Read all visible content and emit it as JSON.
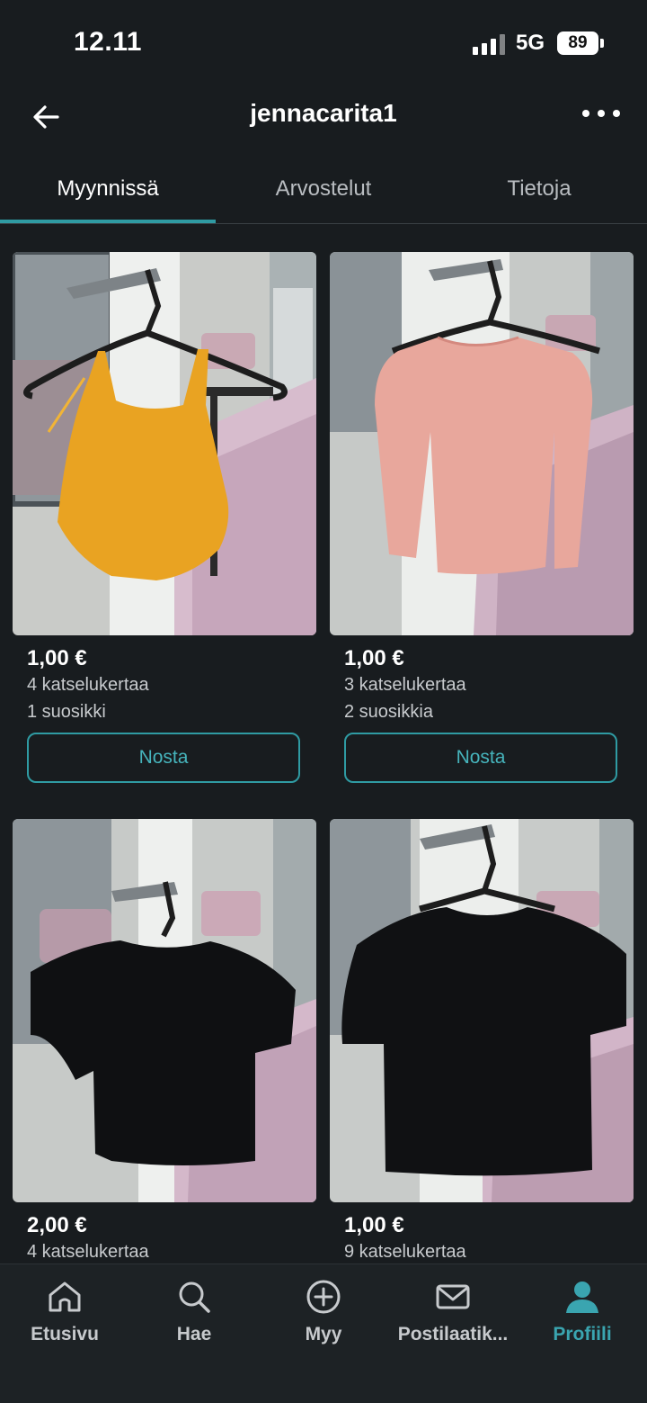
{
  "status": {
    "time": "12.11",
    "network": "5G",
    "battery": "89"
  },
  "header": {
    "title": "jennacarita1",
    "back_icon": "arrow-left-icon",
    "more_icon": "more-dots-icon"
  },
  "tabs": [
    {
      "label": "Myynnissä",
      "active": true
    },
    {
      "label": "Arvostelut",
      "active": false
    },
    {
      "label": "Tietoja",
      "active": false
    }
  ],
  "items": [
    {
      "price": "1,00 €",
      "views": "4 katselukertaa",
      "favorites": "1 suosikki",
      "action": "Nosta",
      "garment_color": "#e9a322"
    },
    {
      "price": "1,00 €",
      "views": "3 katselukertaa",
      "favorites": "2 suosikkia",
      "action": "Nosta",
      "garment_color": "#e8a79c"
    },
    {
      "price": "2,00 €",
      "views": "4 katselukertaa",
      "garment_color": "#0f1012"
    },
    {
      "price": "1,00 €",
      "views": "9 katselukertaa",
      "garment_color": "#101113"
    }
  ],
  "nav": [
    {
      "label": "Etusivu",
      "icon": "home-icon",
      "active": false
    },
    {
      "label": "Hae",
      "icon": "search-icon",
      "active": false
    },
    {
      "label": "Myy",
      "icon": "plus-circle-icon",
      "active": false
    },
    {
      "label": "Postilaatik...",
      "icon": "mail-icon",
      "active": false
    },
    {
      "label": "Profiili",
      "icon": "profile-icon",
      "active": true
    }
  ],
  "colors": {
    "accent": "#2f9ba3",
    "background": "#181c1f",
    "nav_bg": "#1d2225"
  }
}
